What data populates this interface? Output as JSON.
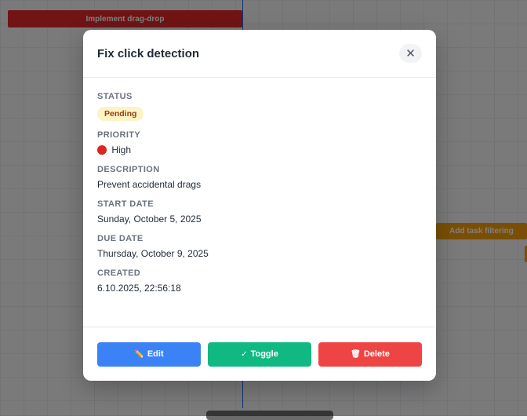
{
  "background": {
    "bars": [
      {
        "label": "Implement drag-drop",
        "color": "#e0292a"
      },
      {
        "label": "Add task filtering",
        "color": "#f59e0b"
      }
    ],
    "today_line_color": "#2563eb"
  },
  "modal": {
    "title": "Fix click detection",
    "close_icon": "close-icon",
    "fields": {
      "status": {
        "label": "STATUS",
        "value": "Pending"
      },
      "priority": {
        "label": "PRIORITY",
        "value": "High",
        "icon": "red-circle-icon"
      },
      "description": {
        "label": "DESCRIPTION",
        "value": "Prevent accidental drags"
      },
      "start_date": {
        "label": "START DATE",
        "value": "Sunday, October 5, 2025"
      },
      "due_date": {
        "label": "DUE DATE",
        "value": "Thursday, October 9, 2025"
      },
      "created": {
        "label": "CREATED",
        "value": "6.10.2025, 22:56:18"
      }
    },
    "buttons": {
      "edit": {
        "label": "Edit",
        "icon": "pencil-icon",
        "color": "#3b82f6"
      },
      "toggle": {
        "label": "Toggle",
        "icon": "check-icon",
        "color": "#10b981"
      },
      "delete": {
        "label": "Delete",
        "icon": "trash-icon",
        "color": "#ef4444"
      }
    }
  }
}
